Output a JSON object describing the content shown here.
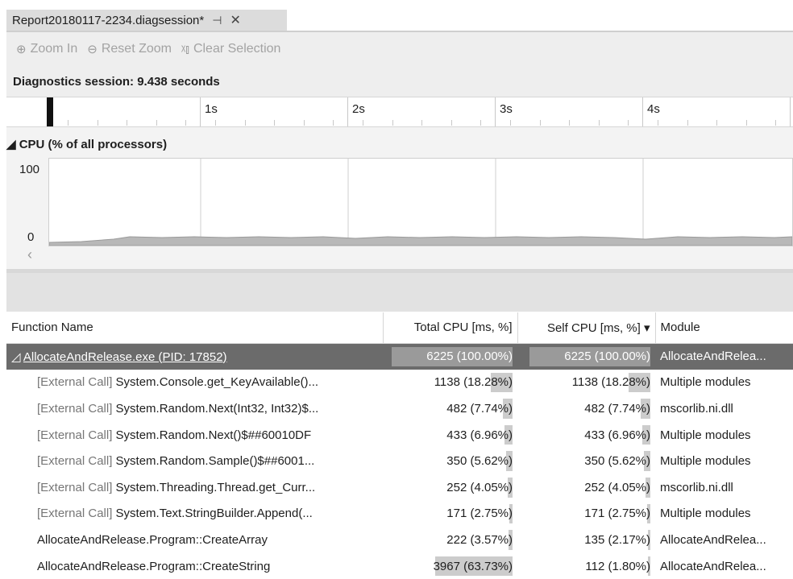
{
  "tab": {
    "title": "Report20180117-2234.diagsession*",
    "pin_glyph": "⊣",
    "close_glyph": "✕"
  },
  "toolbar": {
    "zoom_in": "Zoom In",
    "reset_zoom": "Reset Zoom",
    "clear_selection": "Clear Selection"
  },
  "session": {
    "label": "Diagnostics session: 9.438 seconds"
  },
  "ruler": {
    "ticks": [
      "1s",
      "2s",
      "3s",
      "4s"
    ]
  },
  "cpu_graph": {
    "title": "◢ CPU (% of all processors)",
    "y_max_label": "100",
    "y_min_label": "0",
    "scroll_left": "‹"
  },
  "table": {
    "headers": {
      "function_name": "Function Name",
      "total_cpu": "Total CPU [ms, %]",
      "self_cpu": "Self CPU [ms, %] ▾",
      "module": "Module"
    },
    "rows": [
      {
        "prefix": "◿ ",
        "name": "AllocateAndRelease.exe (PID: 17852)",
        "ext": "",
        "total": "6225 (100.00%)",
        "total_pct": 100,
        "self": "6225 (100.00%)",
        "self_pct": 100,
        "module": "AllocateAndRelea...",
        "selected": true
      },
      {
        "prefix": "",
        "ext": "[External Call]",
        "name": " System.Console.get_KeyAvailable()...",
        "total": "1138 (18.28%)",
        "total_pct": 18.28,
        "self": "1138 (18.28%)",
        "self_pct": 18.28,
        "module": "Multiple modules"
      },
      {
        "prefix": "",
        "ext": "[External Call]",
        "name": " System.Random.Next(Int32, Int32)$...",
        "total": "482 (7.74%)",
        "total_pct": 7.74,
        "self": "482 (7.74%)",
        "self_pct": 7.74,
        "module": "mscorlib.ni.dll"
      },
      {
        "prefix": "",
        "ext": "[External Call]",
        "name": " System.Random.Next()$##60010DF",
        "total": "433 (6.96%)",
        "total_pct": 6.96,
        "self": "433 (6.96%)",
        "self_pct": 6.96,
        "module": "Multiple modules"
      },
      {
        "prefix": "",
        "ext": "[External Call]",
        "name": " System.Random.Sample()$##6001...",
        "total": "350 (5.62%)",
        "total_pct": 5.62,
        "self": "350 (5.62%)",
        "self_pct": 5.62,
        "module": "Multiple modules"
      },
      {
        "prefix": "",
        "ext": "[External Call]",
        "name": " System.Threading.Thread.get_Curr...",
        "total": "252 (4.05%)",
        "total_pct": 4.05,
        "self": "252 (4.05%)",
        "self_pct": 4.05,
        "module": "mscorlib.ni.dll"
      },
      {
        "prefix": "",
        "ext": "[External Call]",
        "name": " System.Text.StringBuilder.Append(...",
        "total": "171 (2.75%)",
        "total_pct": 2.75,
        "self": "171 (2.75%)",
        "self_pct": 2.75,
        "module": "Multiple modules"
      },
      {
        "prefix": "",
        "ext": "",
        "name": "AllocateAndRelease.Program::CreateArray",
        "total": "222 (3.57%)",
        "total_pct": 3.57,
        "self": "135 (2.17%)",
        "self_pct": 2.17,
        "module": "AllocateAndRelea..."
      },
      {
        "prefix": "",
        "ext": "",
        "name": "AllocateAndRelease.Program::CreateString",
        "total": "3967 (63.73%)",
        "total_pct": 63.73,
        "self": "112 (1.80%)",
        "self_pct": 1.8,
        "module": "AllocateAndRelea..."
      }
    ]
  }
}
